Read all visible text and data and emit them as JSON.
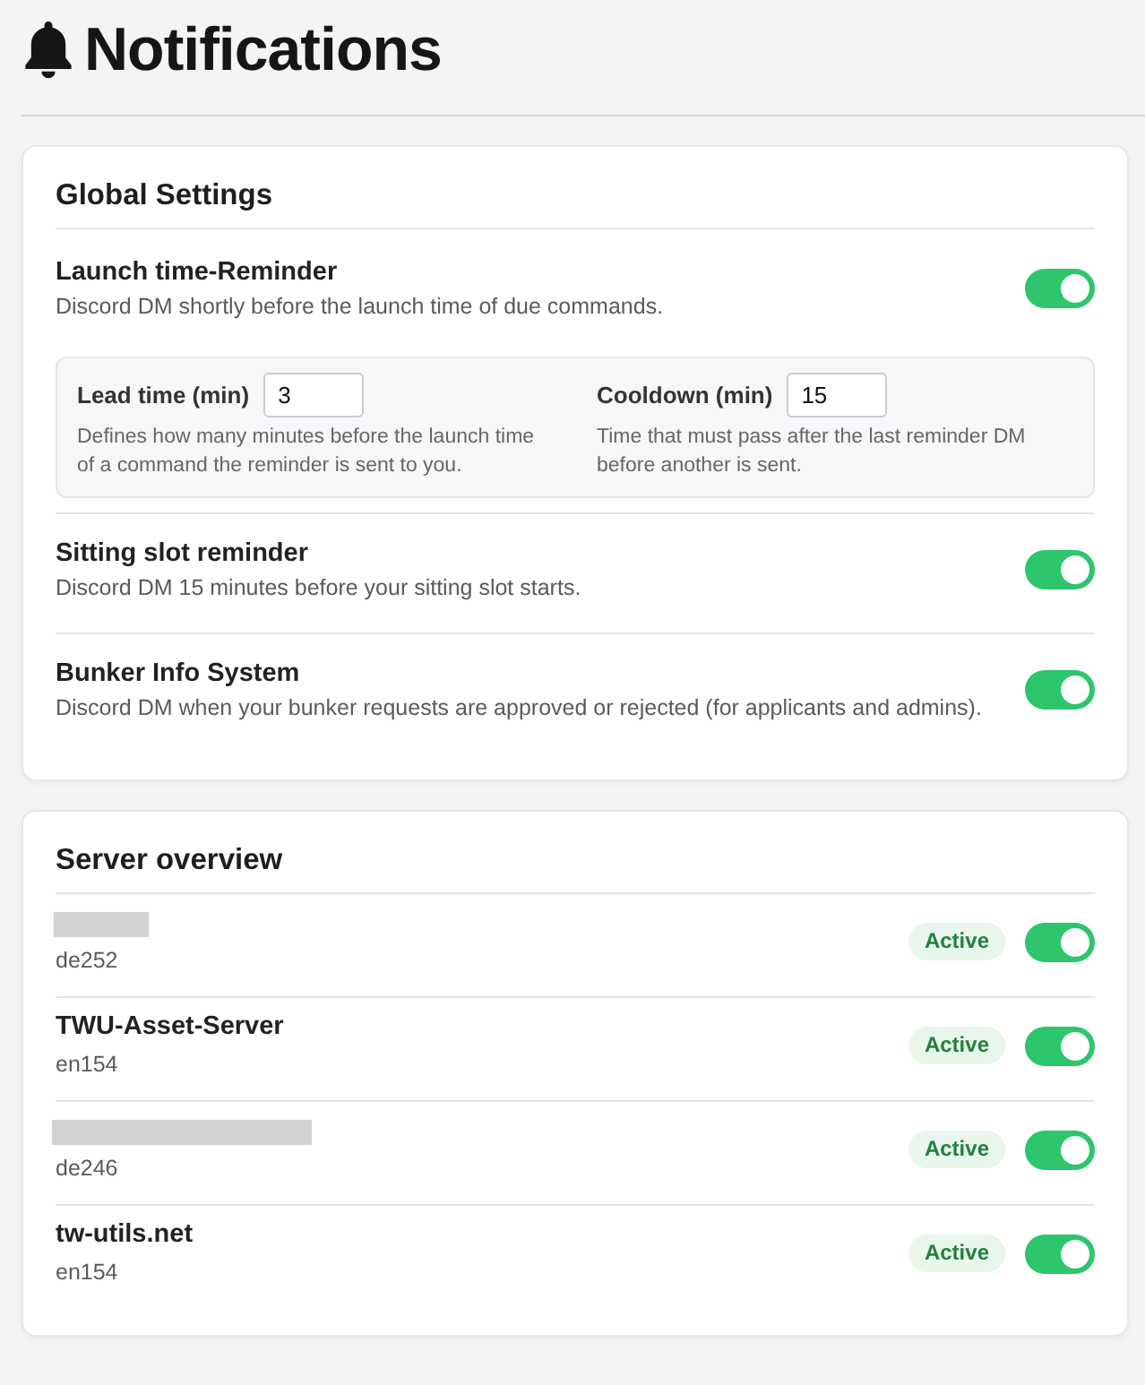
{
  "header": {
    "title": "Notifications"
  },
  "global_settings": {
    "title": "Global Settings",
    "settings": [
      {
        "title": "Launch time-Reminder",
        "description": "Discord DM shortly before the launch time of due commands.",
        "on": true,
        "options": [
          {
            "label": "Lead time (min)",
            "value": "3",
            "help": "Defines how many minutes before the launch time of a command the reminder is sent to you."
          },
          {
            "label": "Cooldown (min)",
            "value": "15",
            "help": "Time that must pass after the last reminder DM before another is sent."
          }
        ]
      },
      {
        "title": "Sitting slot reminder",
        "description": "Discord DM 15 minutes before your sitting slot starts.",
        "on": true
      },
      {
        "title": "Bunker Info System",
        "description": "Discord DM when your bunker requests are approved or rejected (for applicants and admins).",
        "on": true
      }
    ]
  },
  "server_overview": {
    "title": "Server overview",
    "servers": [
      {
        "kind": "redacted_short",
        "region": "de252",
        "status": "Active",
        "on": true
      },
      {
        "kind": "named",
        "name": "TWU-Asset-Server",
        "region": "en154",
        "status": "Active",
        "on": true
      },
      {
        "kind": "redacted_long",
        "region": "de246",
        "status": "Active",
        "on": true
      },
      {
        "kind": "named",
        "name": "tw-utils.net",
        "region": "en154",
        "status": "Active",
        "on": true
      }
    ]
  }
}
